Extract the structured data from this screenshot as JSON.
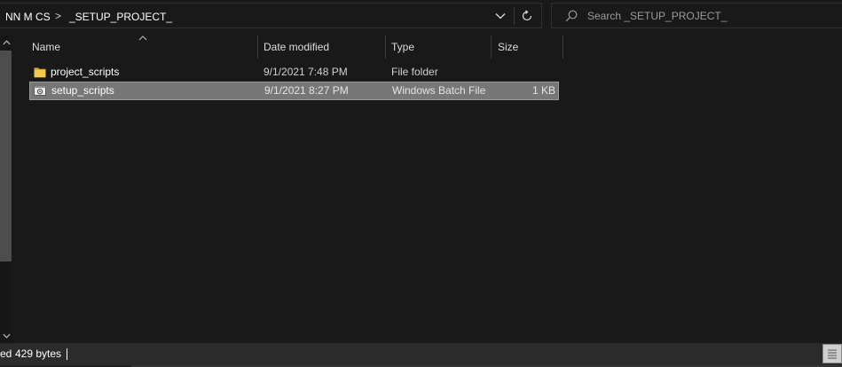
{
  "address": {
    "crumbs": [
      "NN M CS",
      "_SETUP_PROJECT_"
    ],
    "separator": ">",
    "dropdown_icon": "chevron-down-icon",
    "refresh_icon": "refresh-icon"
  },
  "search": {
    "placeholder": "Search _SETUP_PROJECT_",
    "value": "",
    "icon": "search-icon"
  },
  "columns": {
    "name": "Name",
    "date_modified": "Date modified",
    "type": "Type",
    "size": "Size",
    "sort_column": "Name",
    "sort_direction": "ascending"
  },
  "files": [
    {
      "name": "project_scripts",
      "date_modified": "9/1/2021 7:48 PM",
      "type": "File folder",
      "size": "",
      "icon": "folder-icon",
      "selected": false
    },
    {
      "name": "setup_scripts",
      "date_modified": "9/1/2021 8:27 PM",
      "type": "Windows Batch File",
      "size": "1 KB",
      "icon": "batch-file-icon",
      "selected": true
    }
  ],
  "status": {
    "selection_text": "ed",
    "size_text": "429 bytes"
  },
  "colors": {
    "background": "#191919",
    "selection": "#777777",
    "folder": "#f3c94a",
    "status_bar": "#2b2b2b"
  }
}
